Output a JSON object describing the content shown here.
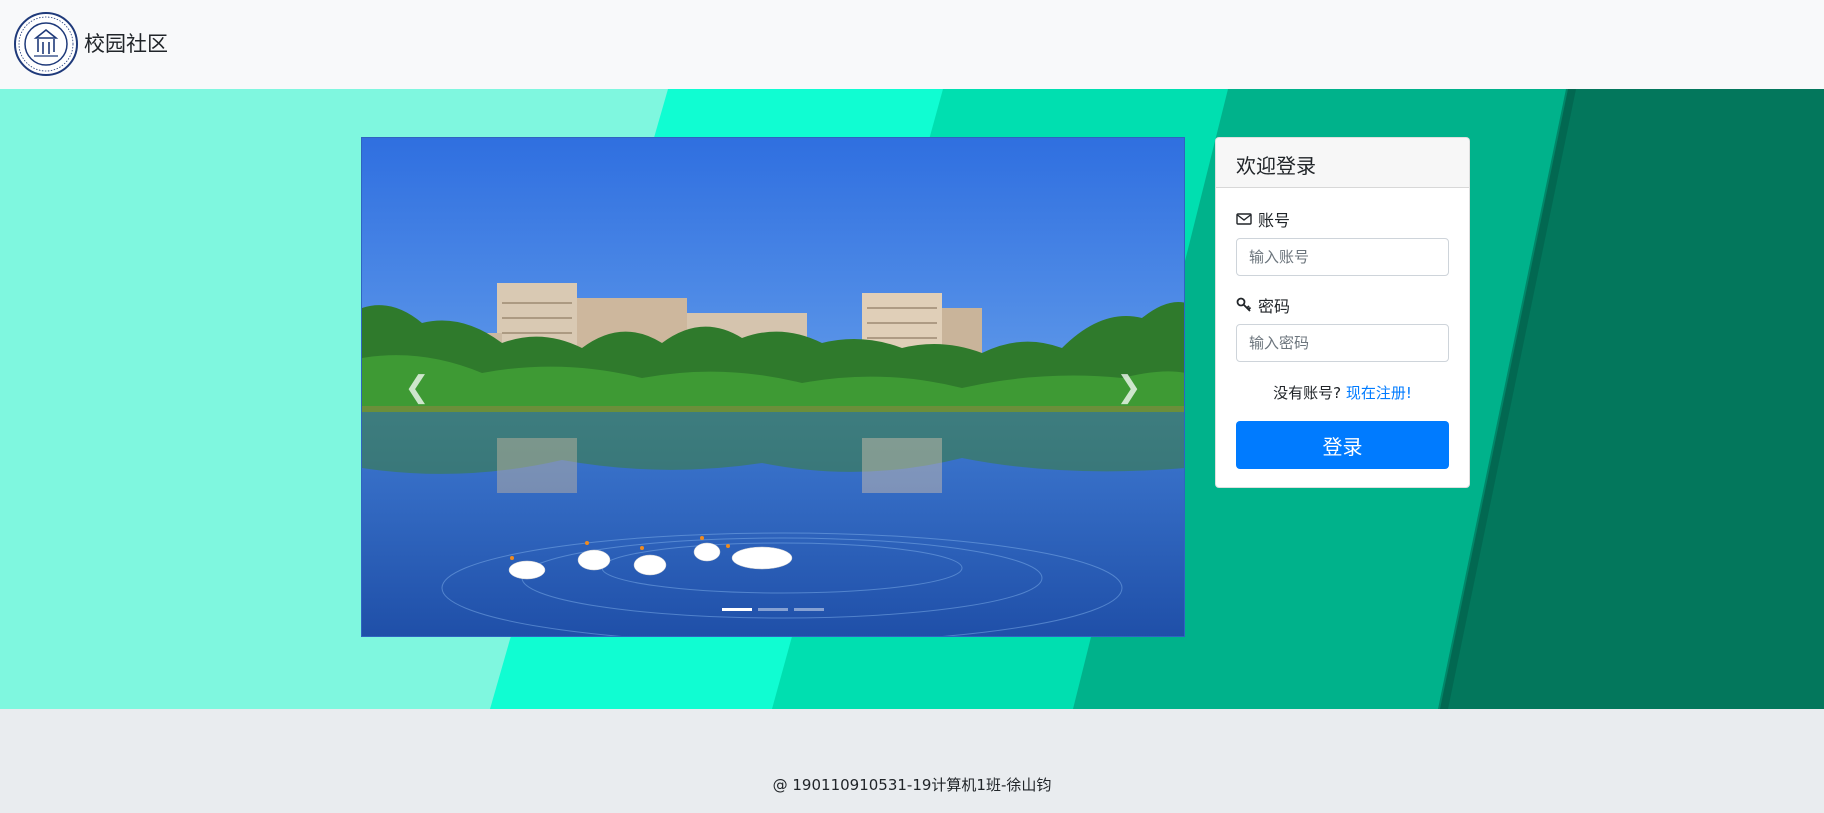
{
  "navbar": {
    "brand_text": "校园社区",
    "logo_icon": "university-seal-icon"
  },
  "carousel": {
    "prev_icon": "chevron-left-icon",
    "next_icon": "chevron-right-icon",
    "prev_glyph": "❮",
    "next_glyph": "❯",
    "slide_count": 3,
    "active_index": 0
  },
  "login": {
    "title": "欢迎登录",
    "account_label": "账号",
    "account_icon": "envelope-icon",
    "account_placeholder": "输入账号",
    "password_label": "密码",
    "password_icon": "key-icon",
    "password_placeholder": "输入密码",
    "no_account_text": "没有账号?",
    "register_link": "现在注册!",
    "login_button": "登录"
  },
  "footer": {
    "text": "@ 190110910531-19计算机1班-徐山钧"
  },
  "colors": {
    "primary": "#007bff",
    "hero_light": "#7ff7df",
    "hero_dark": "#03775c",
    "navbar_bg": "#f8f9fa",
    "footer_bg": "#e9ecef"
  }
}
